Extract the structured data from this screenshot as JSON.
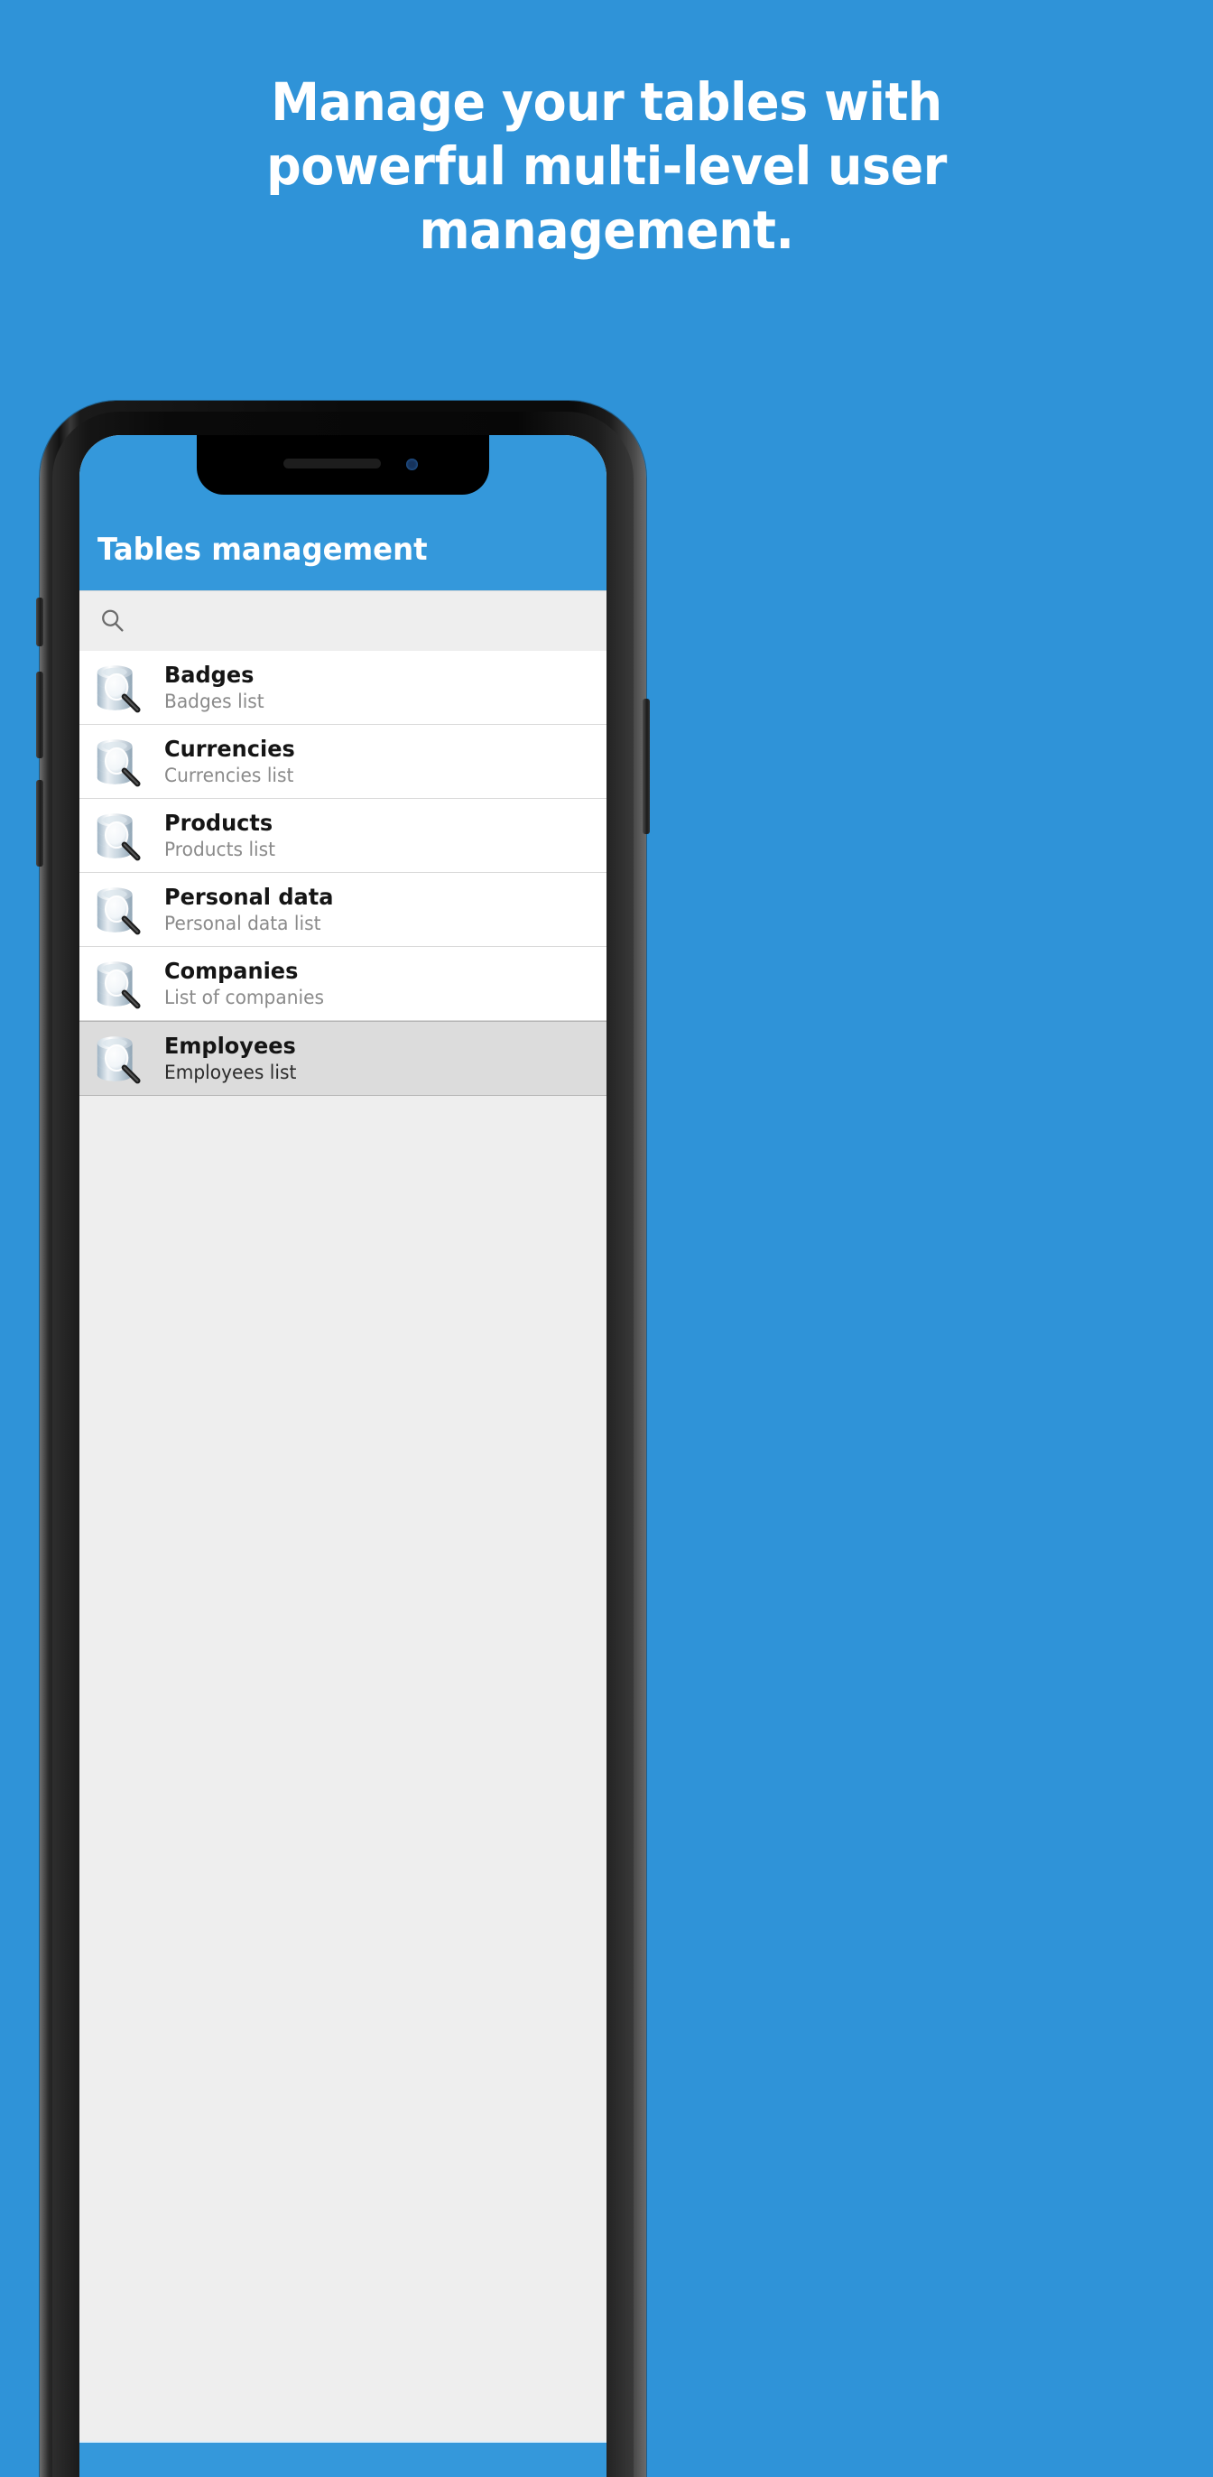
{
  "colors": {
    "background": "#2f93d8",
    "accent": "#3498db",
    "screen_bg": "#eeeeee",
    "row_bg": "#ffffff",
    "row_selected_bg": "#dcdcdc",
    "title_text": "#151515",
    "subtitle_text": "#8a8a8a",
    "headline_text": "#ffffff"
  },
  "headline": {
    "line1": "Manage your tables with",
    "line2": "powerful multi-level user",
    "line3": "management."
  },
  "app": {
    "appbar": {
      "title": "Tables management"
    },
    "search": {
      "icon": "search-icon",
      "value": "",
      "placeholder": ""
    },
    "list": {
      "rows": [
        {
          "icon": "database-search-icon",
          "title": "Badges",
          "subtitle": "Badges list",
          "selected": false
        },
        {
          "icon": "database-search-icon",
          "title": "Currencies",
          "subtitle": "Currencies list",
          "selected": false
        },
        {
          "icon": "database-search-icon",
          "title": "Products",
          "subtitle": "Products list",
          "selected": false
        },
        {
          "icon": "database-search-icon",
          "title": "Personal data",
          "subtitle": "Personal data list",
          "selected": false
        },
        {
          "icon": "database-search-icon",
          "title": "Companies",
          "subtitle": "List of companies",
          "selected": false
        },
        {
          "icon": "database-search-icon",
          "title": "Employees",
          "subtitle": "Employees list",
          "selected": true
        }
      ]
    }
  },
  "device": {
    "speaker": "speaker-grille",
    "camera": "front-camera-icon"
  }
}
